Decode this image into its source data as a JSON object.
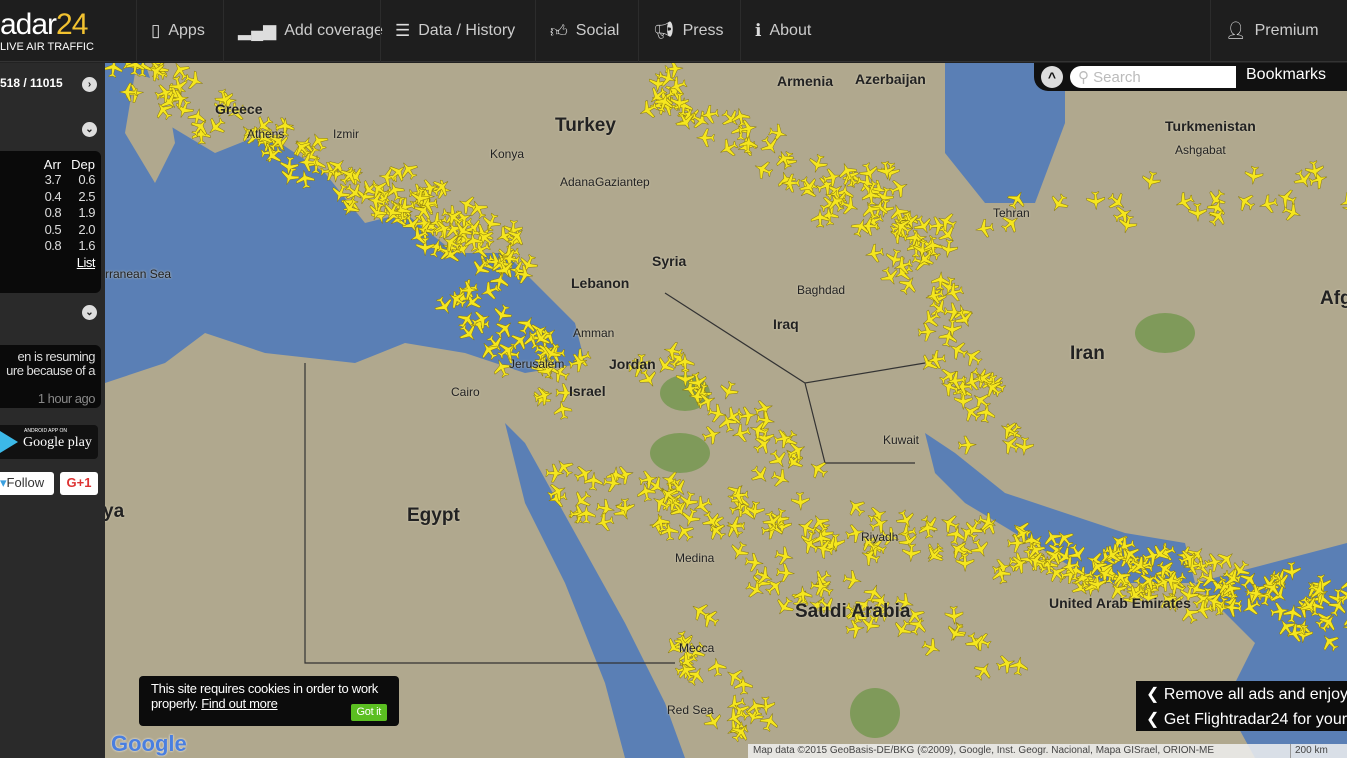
{
  "header": {
    "logo_main": "adar",
    "logo_num": "24",
    "logo_sub": "LIVE AIR TRAFFIC",
    "nav": [
      {
        "label": "Apps",
        "icon": "phone-icon"
      },
      {
        "label": "Add coverage",
        "icon": "signal-icon"
      },
      {
        "label": "Data / History",
        "icon": "database-icon"
      },
      {
        "label": "Social",
        "icon": "thumbs-up-icon"
      },
      {
        "label": "Press",
        "icon": "megaphone-icon"
      },
      {
        "label": "About",
        "icon": "info-icon"
      },
      {
        "label": "Premium",
        "icon": "user-icon"
      }
    ]
  },
  "sidebar": {
    "flight_count": "518 / 11015",
    "delays": {
      "headers": [
        "Arr",
        "Dep"
      ],
      "rows": [
        [
          "3.7",
          "0.6"
        ],
        [
          "0.4",
          "2.5"
        ],
        [
          "0.8",
          "1.9"
        ],
        [
          "0.5",
          "2.0"
        ],
        [
          "0.8",
          "1.6"
        ]
      ],
      "list_link": "List"
    },
    "news": {
      "line1": "en is resuming",
      "line2": "ure because of a",
      "time": "1 hour ago"
    },
    "google_play": {
      "small": "ANDROID APP ON",
      "label": "Google play"
    },
    "follow": "Follow",
    "gplus": "G+1"
  },
  "search": {
    "placeholder": "Search",
    "bookmarks": "Bookmarks"
  },
  "map": {
    "labels": [
      {
        "t": "Turkey",
        "c": "big"
      },
      {
        "t": "Greece",
        "c": ""
      },
      {
        "t": "Athens",
        "c": "sm"
      },
      {
        "t": "Izmir",
        "c": "sm"
      },
      {
        "t": "Konya",
        "c": "sm"
      },
      {
        "t": "Adana",
        "c": "sm"
      },
      {
        "t": "Gaziantep",
        "c": "sm"
      },
      {
        "t": "Armenia",
        "c": ""
      },
      {
        "t": "Azerbaijan",
        "c": ""
      },
      {
        "t": "Turkmenistan",
        "c": ""
      },
      {
        "t": "Ashgabat",
        "c": "sm"
      },
      {
        "t": "Tehran",
        "c": "sm"
      },
      {
        "t": "Syria",
        "c": ""
      },
      {
        "t": "Lebanon",
        "c": ""
      },
      {
        "t": "Baghdad",
        "c": "sm"
      },
      {
        "t": "Iraq",
        "c": ""
      },
      {
        "t": "Amman",
        "c": "sm"
      },
      {
        "t": "Jordan",
        "c": ""
      },
      {
        "t": "Jerusalem",
        "c": "sm"
      },
      {
        "t": "Israel",
        "c": ""
      },
      {
        "t": "Cairo",
        "c": "sm"
      },
      {
        "t": "Egypt",
        "c": "big"
      },
      {
        "t": "Iran",
        "c": "big"
      },
      {
        "t": "Afg",
        "c": "big"
      },
      {
        "t": "Kuwait",
        "c": "sm"
      },
      {
        "t": "Riyadh",
        "c": "sm"
      },
      {
        "t": "Medina",
        "c": "sm"
      },
      {
        "t": "Saudi Arabia",
        "c": "big"
      },
      {
        "t": "United Arab Emirates",
        "c": ""
      },
      {
        "t": "Mecca",
        "c": "sm"
      },
      {
        "t": "ya",
        "c": "big"
      },
      {
        "t": "rranean Sea",
        "c": "sm"
      },
      {
        "t": "Red Sea",
        "c": "sm"
      }
    ]
  },
  "cookie": {
    "text": "This site requires cookies in order to work properly.",
    "link": "Find out more",
    "button": "Got it"
  },
  "promos": [
    "Remove all ads and enjoy",
    "Get Flightradar24 for your"
  ],
  "attribution": "Map data ©2015 GeoBasis-DE/BKG (©2009), Google, Inst. Geogr. Nacional, Mapa GISrael, ORION-ME",
  "scale": "200 km",
  "colors": {
    "accent": "#f2c230",
    "plane": "#f5e61e",
    "sea": "#5a7fb5",
    "land": "#b0a88e"
  }
}
